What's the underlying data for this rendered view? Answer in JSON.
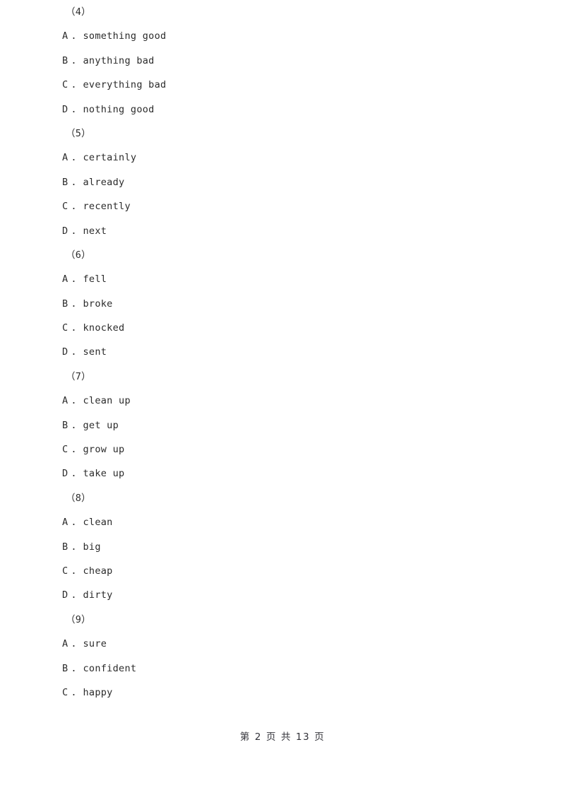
{
  "document": {
    "page_background": "#ffffff",
    "text_color": "#2b2b2b"
  },
  "questions": [
    {
      "number": "（4）",
      "options": [
        {
          "letter": "A",
          "dot": ".",
          "text": "something good"
        },
        {
          "letter": "B",
          "dot": ".",
          "text": "anything bad"
        },
        {
          "letter": "C",
          "dot": ".",
          "text": "everything bad"
        },
        {
          "letter": "D",
          "dot": ".",
          "text": "nothing good"
        }
      ]
    },
    {
      "number": "（5）",
      "options": [
        {
          "letter": "A",
          "dot": ".",
          "text": "certainly"
        },
        {
          "letter": "B",
          "dot": ".",
          "text": "already"
        },
        {
          "letter": "C",
          "dot": ".",
          "text": "recently"
        },
        {
          "letter": "D",
          "dot": ".",
          "text": "next"
        }
      ]
    },
    {
      "number": "（6）",
      "options": [
        {
          "letter": "A",
          "dot": ".",
          "text": "fell"
        },
        {
          "letter": "B",
          "dot": ".",
          "text": "broke"
        },
        {
          "letter": "C",
          "dot": ".",
          "text": "knocked"
        },
        {
          "letter": "D",
          "dot": ".",
          "text": "sent"
        }
      ]
    },
    {
      "number": "（7）",
      "options": [
        {
          "letter": "A",
          "dot": ".",
          "text": "clean up"
        },
        {
          "letter": "B",
          "dot": ".",
          "text": "get up"
        },
        {
          "letter": "C",
          "dot": ".",
          "text": "grow up"
        },
        {
          "letter": "D",
          "dot": ".",
          "text": "take up"
        }
      ]
    },
    {
      "number": "（8）",
      "options": [
        {
          "letter": "A",
          "dot": ".",
          "text": "clean"
        },
        {
          "letter": "B",
          "dot": ".",
          "text": "big"
        },
        {
          "letter": "C",
          "dot": ".",
          "text": "cheap"
        },
        {
          "letter": "D",
          "dot": ".",
          "text": "dirty"
        }
      ]
    },
    {
      "number": "（9）",
      "options": [
        {
          "letter": "A",
          "dot": ".",
          "text": "sure"
        },
        {
          "letter": "B",
          "dot": ".",
          "text": "confident"
        },
        {
          "letter": "C",
          "dot": ".",
          "text": "happy"
        }
      ]
    }
  ],
  "footer": {
    "text": "第 2 页 共 13 页",
    "current_page": "2",
    "total_pages": "13"
  }
}
